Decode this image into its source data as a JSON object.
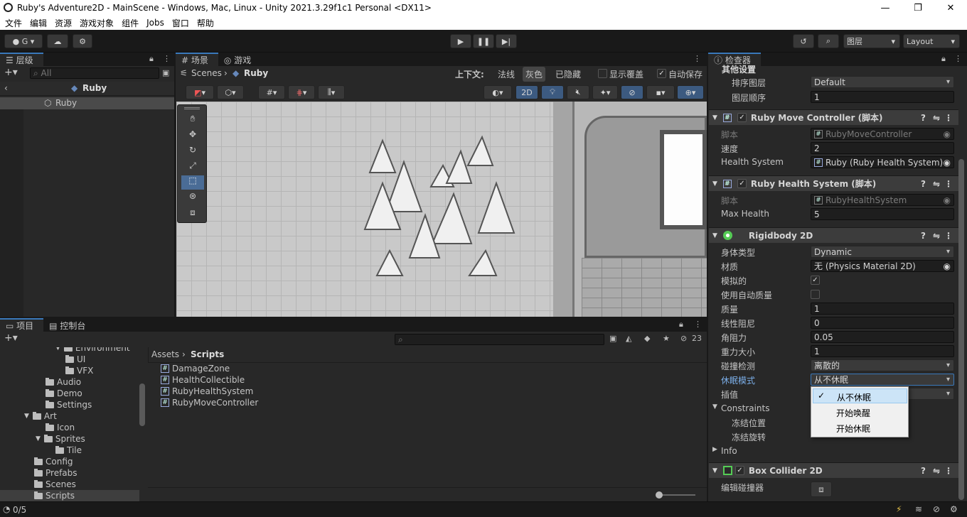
{
  "window": {
    "title": "Ruby's Adventure2D - MainScene - Windows, Mac, Linux - Unity 2021.3.29f1c1 Personal <DX11>",
    "min": "—",
    "max": "❐",
    "close": "✕"
  },
  "menu": [
    "文件",
    "编辑",
    "资源",
    "游戏对象",
    "组件",
    "Jobs",
    "窗口",
    "帮助"
  ],
  "toolbar": {
    "account": "G",
    "layers": "图层",
    "layout": "Layout"
  },
  "hierarchy": {
    "tab": "层级",
    "search_placeholder": "All",
    "root": "Ruby",
    "child": "Ruby"
  },
  "scene": {
    "tab_scene": "场景",
    "tab_game": "游戏",
    "breadcrumb_root": "Scenes",
    "breadcrumb_current": "Ruby",
    "context_label": "上下文:",
    "mode_normal": "法线",
    "mode_gray": "灰色",
    "mode_hidden": "已隐藏",
    "overlay": "显示覆盖",
    "autosave": "自动保存",
    "btn_2d": "2D"
  },
  "project": {
    "tab_project": "项目",
    "tab_console": "控制台",
    "count": "23",
    "breadcrumb_root": "Assets",
    "breadcrumb_current": "Scripts",
    "tree": [
      {
        "label": "Environment",
        "indent": 92
      },
      {
        "label": "UI",
        "indent": 92
      },
      {
        "label": "VFX",
        "indent": 92
      },
      {
        "label": "Audio",
        "indent": 64
      },
      {
        "label": "Demo",
        "indent": 64
      },
      {
        "label": "Settings",
        "indent": 64
      },
      {
        "label": "Art",
        "indent": 48
      },
      {
        "label": "Icon",
        "indent": 64
      },
      {
        "label": "Sprites",
        "indent": 64
      },
      {
        "label": "Tile",
        "indent": 78
      },
      {
        "label": "Config",
        "indent": 48
      },
      {
        "label": "Prefabs",
        "indent": 48
      },
      {
        "label": "Scenes",
        "indent": 48
      },
      {
        "label": "Scripts",
        "indent": 48
      }
    ],
    "files": [
      "DamageZone",
      "HealthCollectible",
      "RubyHealthSystem",
      "RubyMoveController"
    ]
  },
  "status": {
    "text": "0/5"
  },
  "inspector": {
    "tab": "检查器",
    "other": {
      "title": "其他设置",
      "sort_layer_label": "排序图层",
      "sort_layer": "Default",
      "order_label": "图层顺序",
      "order": "1"
    },
    "move": {
      "title": "Ruby Move Controller   (脚本)",
      "script_label": "脚本",
      "script": "RubyMoveController",
      "speed_label": "速度",
      "speed": "2",
      "health_label": "Health System",
      "health": "Ruby (Ruby Health System)"
    },
    "healthsys": {
      "title": "Ruby Health System   (脚本)",
      "script_label": "脚本",
      "script": "RubyHealthSystem",
      "max_label": "Max Health",
      "max": "5"
    },
    "rb": {
      "title": "Rigidbody 2D",
      "body_type_label": "身体类型",
      "body_type": "Dynamic",
      "material_label": "材质",
      "material": "无 (Physics Material 2D)",
      "simulated_label": "模拟的",
      "automass_label": "使用自动质量",
      "mass_label": "质量",
      "mass": "1",
      "lin_label": "线性阻尼",
      "lin": "0",
      "ang_label": "角阻力",
      "ang": "0.05",
      "grav_label": "重力大小",
      "grav": "1",
      "coll_label": "碰撞检测",
      "coll": "离散的",
      "sleep_label": "休眠模式",
      "sleep": "从不休眠",
      "interp_label": "插值",
      "constraints": "Constraints",
      "freeze_pos": "冻结位置",
      "freeze_rot": "冻结旋转",
      "info": "Info"
    },
    "box": {
      "title": "Box Collider 2D",
      "edit_label": "编辑碰撞器"
    },
    "dropdown": [
      "从不休眠",
      "开始唤醒",
      "开始休眠"
    ]
  }
}
